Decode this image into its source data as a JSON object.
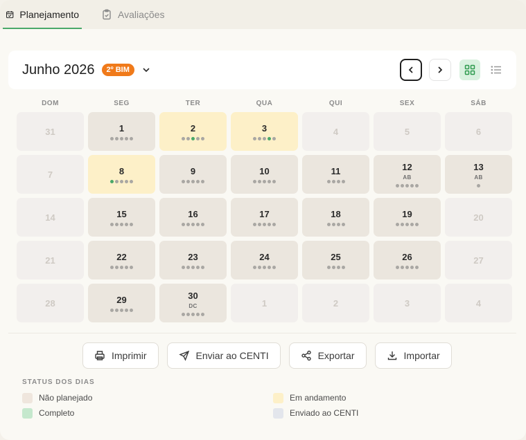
{
  "tabs": [
    {
      "label": "Planejamento",
      "active": true,
      "icon": "calendar-check-icon"
    },
    {
      "label": "Avaliações",
      "active": false,
      "icon": "clipboard-check-icon"
    }
  ],
  "header": {
    "month": "Junho 2026",
    "bimester": "2º BIM"
  },
  "weekdays": [
    "DOM",
    "SEG",
    "TER",
    "QUA",
    "QUI",
    "SEX",
    "SÁB"
  ],
  "days": [
    {
      "n": "31",
      "state": "muted"
    },
    {
      "n": "1",
      "state": "plain",
      "dots": "ggggg"
    },
    {
      "n": "2",
      "state": "progress",
      "dots": "ggGgg"
    },
    {
      "n": "3",
      "state": "progress",
      "dots": "gggGg"
    },
    {
      "n": "4",
      "state": "muted"
    },
    {
      "n": "5",
      "state": "muted"
    },
    {
      "n": "6",
      "state": "muted"
    },
    {
      "n": "7",
      "state": "muted"
    },
    {
      "n": "8",
      "state": "progress",
      "dots": "Ggggg"
    },
    {
      "n": "9",
      "state": "plain",
      "dots": "ggggg"
    },
    {
      "n": "10",
      "state": "plain",
      "dots": "ggggg"
    },
    {
      "n": "11",
      "state": "plain",
      "dots": "gggg"
    },
    {
      "n": "12",
      "state": "plain",
      "tag": "AB",
      "dots": "ggggg"
    },
    {
      "n": "13",
      "state": "plain",
      "tag": "AB",
      "dots": "g"
    },
    {
      "n": "14",
      "state": "muted"
    },
    {
      "n": "15",
      "state": "plain",
      "dots": "ggggg"
    },
    {
      "n": "16",
      "state": "plain",
      "dots": "ggggg"
    },
    {
      "n": "17",
      "state": "plain",
      "dots": "ggggg"
    },
    {
      "n": "18",
      "state": "plain",
      "dots": "gggg"
    },
    {
      "n": "19",
      "state": "plain",
      "dots": "ggggg"
    },
    {
      "n": "20",
      "state": "muted"
    },
    {
      "n": "21",
      "state": "muted"
    },
    {
      "n": "22",
      "state": "plain",
      "dots": "ggggg"
    },
    {
      "n": "23",
      "state": "plain",
      "dots": "ggggg"
    },
    {
      "n": "24",
      "state": "plain",
      "dots": "ggggg"
    },
    {
      "n": "25",
      "state": "plain",
      "dots": "gggg"
    },
    {
      "n": "26",
      "state": "plain",
      "dots": "ggggg"
    },
    {
      "n": "27",
      "state": "muted"
    },
    {
      "n": "28",
      "state": "muted"
    },
    {
      "n": "29",
      "state": "plain",
      "dots": "ggggg"
    },
    {
      "n": "30",
      "state": "plain",
      "tag": "DC",
      "dots": "ggggg"
    },
    {
      "n": "1",
      "state": "muted"
    },
    {
      "n": "2",
      "state": "muted"
    },
    {
      "n": "3",
      "state": "muted"
    },
    {
      "n": "4",
      "state": "muted"
    }
  ],
  "actions": {
    "print": "Imprimir",
    "send": "Enviar ao CENTI",
    "export": "Exportar",
    "import": "Importar"
  },
  "legend": {
    "title": "STATUS DOS DIAS",
    "items": [
      {
        "label": "Não planejado",
        "color": "#efe6dd"
      },
      {
        "label": "Em andamento",
        "color": "#fdf0c8"
      },
      {
        "label": "Completo",
        "color": "#c5e8cd"
      },
      {
        "label": "Enviado ao CENTI",
        "color": "#e3e6ec"
      }
    ]
  },
  "colors": {
    "accent_green": "#4aa869",
    "bim_orange": "#f07a1a"
  }
}
